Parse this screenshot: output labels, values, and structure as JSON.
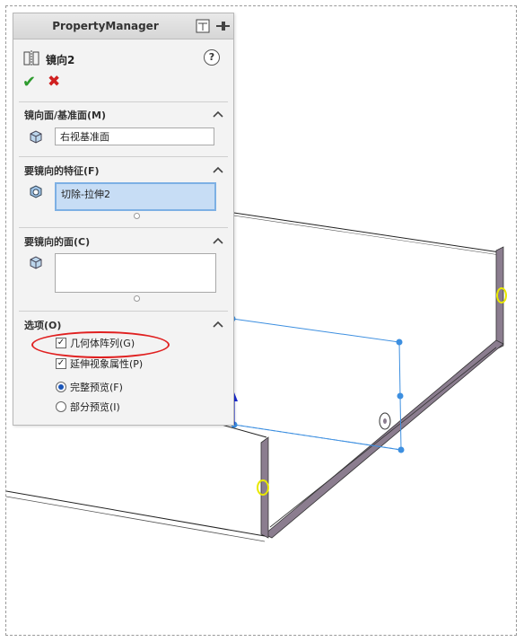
{
  "property_manager": {
    "title": "PropertyManager",
    "feature_name": "镜向2",
    "help_label": "?",
    "ok_label": "✔",
    "cancel_label": "✖",
    "sections": {
      "mirror_plane": {
        "title": "镜向面/基准面(M)",
        "value": "右视基准面"
      },
      "features_to_mirror": {
        "title": "要镜向的特征(F)",
        "items": [
          "切除-拉伸2"
        ]
      },
      "faces_to_mirror": {
        "title": "要镜向的面(C)",
        "items": []
      },
      "options": {
        "title": "选项(O)",
        "geometry_pattern": {
          "label": "几何体阵列(G)",
          "checked": true
        },
        "propagate_visual": {
          "label": "延伸视象属性(P)",
          "checked": true
        },
        "full_preview": {
          "label": "完整预览(F)",
          "selected": true
        },
        "partial_preview": {
          "label": "部分预览(I)",
          "selected": false
        }
      }
    }
  },
  "colors": {
    "sheet_metal_edge": "#8b7d8f",
    "sketch_blue": "#3d8fe0",
    "highlight_yellow": "#e8e800",
    "annotation_red": "#e02020"
  }
}
